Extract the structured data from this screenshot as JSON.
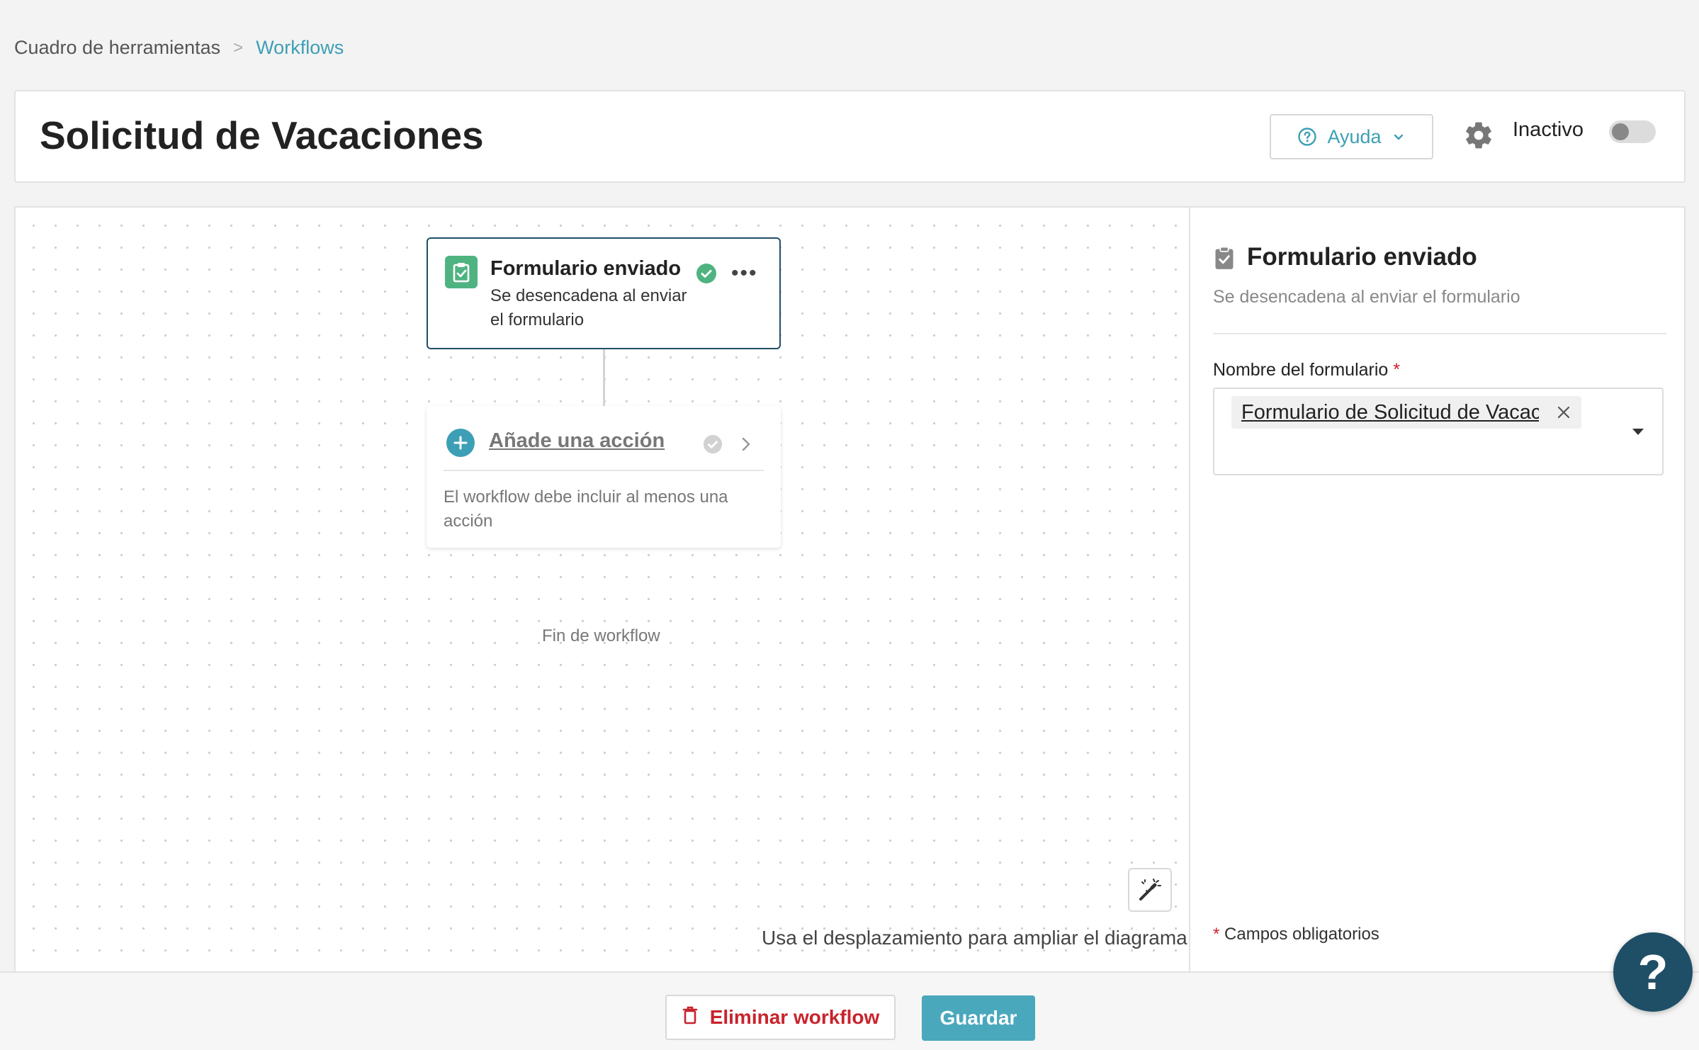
{
  "breadcrumb": {
    "parent": "Cuadro de herramientas",
    "separator": ">",
    "current": "Workflows"
  },
  "header": {
    "title": "Solicitud de Vacaciones",
    "help_label": "Ayuda",
    "status_label": "Inactivo",
    "status_active": false
  },
  "canvas": {
    "trigger": {
      "title": "Formulario enviado",
      "subtitle": "Se desencadena al enviar el formulario",
      "more": "•••"
    },
    "action": {
      "title": "Añade una acción",
      "description": "El workflow debe incluir al menos una acción"
    },
    "end_label": "Fin de workflow",
    "scroll_hint": "Usa el desplazamiento para ampliar el diagrama"
  },
  "panel": {
    "title": "Formulario enviado",
    "subtitle": "Se desencadena al enviar el formulario",
    "field_label": "Nombre del formulario",
    "required_mark": "*",
    "selected_form": "Formulario de Solicitud de Vacaci",
    "required_note": "Campos obligatorios"
  },
  "footer": {
    "delete_label": "Eliminar workflow",
    "save_label": "Guardar"
  },
  "help_fab": "?",
  "colors": {
    "accent": "#3d9fb5",
    "trigger_green": "#4fb381",
    "danger": "#c8232c",
    "navy": "#1f4f66"
  },
  "icons": [
    "help-circle-icon",
    "chevron-down-icon",
    "gear-icon",
    "clipboard-check-icon",
    "check-circle-icon",
    "more-icon",
    "plus-circle-icon",
    "chevron-right-icon",
    "magic-wand-icon",
    "close-icon",
    "trash-icon"
  ]
}
